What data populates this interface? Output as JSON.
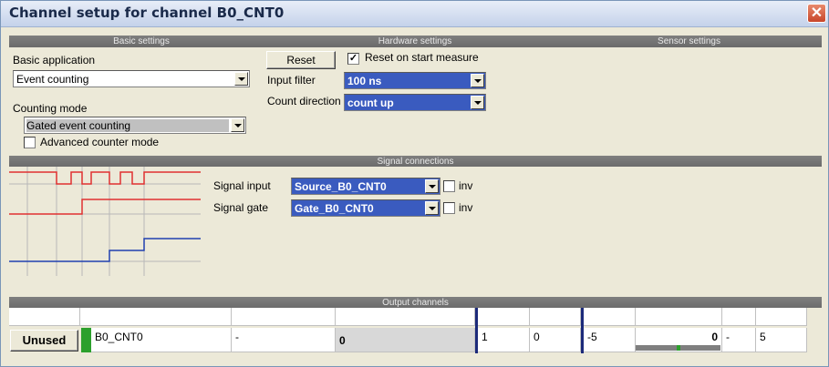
{
  "window": {
    "title": "Channel setup for channel B0_CNT0",
    "close_glyph": "✕"
  },
  "sections": {
    "basic": "Basic settings",
    "hardware": "Hardware settings",
    "sensor": "Sensor settings",
    "signal": "Signal connections",
    "output": "Output channels"
  },
  "basic": {
    "application_label": "Basic application",
    "application_value": "Event counting",
    "mode_label": "Counting mode",
    "mode_value": "Gated event counting",
    "advanced_label": "Advanced counter mode",
    "advanced_checked": false
  },
  "hardware": {
    "reset_label": "Reset",
    "reset_on_start_label": "Reset on start measure",
    "reset_on_start_checked": true,
    "input_filter_label": "Input filter",
    "input_filter_value": "100 ns",
    "count_direction_label": "Count direction",
    "count_direction_value": "count up"
  },
  "signals": {
    "input_label": "Signal input",
    "input_value": "Source_B0_CNT0",
    "input_inv_label": "inv",
    "gate_label": "Signal gate",
    "gate_value": "Gate_B0_CNT0",
    "gate_inv_label": "inv",
    "colors": {
      "source": "#e03030",
      "gate": "#e03030",
      "counter": "#2040b0"
    }
  },
  "output": {
    "status_button": "Unused",
    "status_color": "#2ca02c",
    "channel_name": "B0_CNT0",
    "unit": "-",
    "value": "0",
    "factor": "1",
    "offset": "0",
    "min": "-5",
    "bar_value": "0",
    "bar_fraction": 0.5,
    "bar_unit": "-",
    "max": "5"
  }
}
